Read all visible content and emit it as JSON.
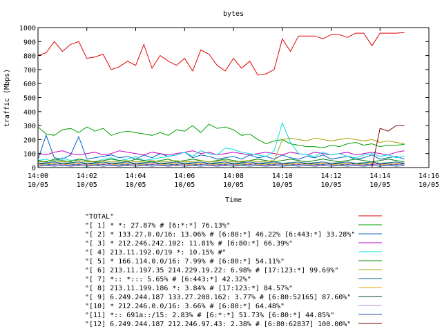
{
  "chart_data": {
    "type": "line",
    "title": "bytes",
    "xlabel": "Time",
    "ylabel": "traffic (Mbps)",
    "ylim": [
      0,
      1000
    ],
    "yticks": [
      0,
      100,
      200,
      300,
      400,
      500,
      600,
      700,
      800,
      900,
      1000
    ],
    "xlim": [
      "14:00",
      "14:16"
    ],
    "xticks": [
      {
        "time": "14:00",
        "date": "10/05"
      },
      {
        "time": "14:02",
        "date": "10/05"
      },
      {
        "time": "14:04",
        "date": "10/05"
      },
      {
        "time": "14:06",
        "date": "10/05"
      },
      {
        "time": "14:08",
        "date": "10/05"
      },
      {
        "time": "14:10",
        "date": "10/05"
      },
      {
        "time": "14:12",
        "date": "10/05"
      },
      {
        "time": "14:14",
        "date": "10/05"
      },
      {
        "time": "14:16",
        "date": "10/05"
      }
    ],
    "grid": false,
    "legend_position": "bottom",
    "x": [
      "14:00",
      "14:00:20",
      "14:00:40",
      "14:01",
      "14:01:20",
      "14:01:40",
      "14:02",
      "14:02:20",
      "14:02:40",
      "14:03",
      "14:03:20",
      "14:03:40",
      "14:04",
      "14:04:20",
      "14:04:40",
      "14:05",
      "14:05:20",
      "14:05:40",
      "14:06",
      "14:06:20",
      "14:06:40",
      "14:07",
      "14:07:20",
      "14:07:40",
      "14:08",
      "14:08:20",
      "14:08:40",
      "14:09",
      "14:09:20",
      "14:09:40",
      "14:10",
      "14:10:20",
      "14:10:40",
      "14:11",
      "14:11:20",
      "14:11:40",
      "14:12",
      "14:12:20",
      "14:12:40",
      "14:13",
      "14:13:20",
      "14:13:40",
      "14:14",
      "14:14:20",
      "14:14:40",
      "14:15"
    ],
    "series": [
      {
        "name": "\"TOTAL\"",
        "color": "#e00000",
        "values": [
          800,
          820,
          900,
          830,
          880,
          900,
          780,
          790,
          810,
          700,
          720,
          760,
          730,
          880,
          710,
          800,
          760,
          730,
          780,
          690,
          840,
          810,
          730,
          690,
          780,
          710,
          760,
          660,
          670,
          700,
          920,
          830,
          940,
          940,
          940,
          920,
          950,
          950,
          930,
          960,
          960,
          870,
          960,
          960,
          960,
          965
        ]
      },
      {
        "name": "\"[ 1] * *: 27.87% # [6:*:*] 76.13%\"",
        "color": "#00a000",
        "values": [
          290,
          240,
          230,
          270,
          280,
          250,
          290,
          260,
          280,
          230,
          250,
          260,
          250,
          240,
          230,
          250,
          230,
          270,
          260,
          300,
          250,
          310,
          280,
          290,
          270,
          230,
          240,
          200,
          170,
          190,
          200,
          170,
          160,
          150,
          150,
          140,
          160,
          150,
          170,
          180,
          160,
          170,
          150,
          160,
          160,
          165
        ]
      },
      {
        "name": "\"[ 2] * 133.27.0.0/16: 13.06% # [6:80:*] 46.22% [6:443:*] 33.28%\"",
        "color": "#0060c0",
        "values": [
          60,
          230,
          70,
          60,
          90,
          220,
          60,
          70,
          80,
          90,
          70,
          80,
          60,
          90,
          70,
          100,
          80,
          90,
          110,
          70,
          90,
          80,
          60,
          70,
          80,
          60,
          90,
          70,
          80,
          60,
          90,
          70,
          60,
          80,
          70,
          90,
          60,
          70,
          80,
          60,
          70,
          90,
          60,
          70,
          80,
          60
        ]
      },
      {
        "name": "\"[ 3] * 212.246.242.102: 11.81% # [6:80:*] 66.39%\"",
        "color": "#c000c0",
        "values": [
          100,
          90,
          110,
          120,
          100,
          90,
          100,
          110,
          90,
          100,
          120,
          110,
          100,
          90,
          110,
          100,
          90,
          100,
          110,
          120,
          100,
          110,
          90,
          100,
          110,
          100,
          90,
          100,
          110,
          100,
          90,
          110,
          100,
          90,
          110,
          100,
          90,
          100,
          110,
          90,
          100,
          110,
          100,
          90,
          110,
          120
        ]
      },
      {
        "name": "\"[ 4] 213.11.192.0/19 *: 10.15% #\"",
        "color": "#00e0e0",
        "values": [
          50,
          60,
          40,
          70,
          50,
          60,
          50,
          40,
          60,
          70,
          50,
          60,
          80,
          50,
          60,
          70,
          80,
          90,
          110,
          80,
          120,
          100,
          90,
          140,
          130,
          110,
          100,
          90,
          80,
          120,
          320,
          180,
          100,
          90,
          80,
          110,
          90,
          100,
          80,
          70,
          90,
          100,
          80,
          90,
          70,
          80
        ]
      },
      {
        "name": "\"[ 5] * 166.114.0.0/16: 7.99% # [6:80:*] 54.11%\"",
        "color": "#008000",
        "values": [
          50,
          40,
          60,
          50,
          40,
          60,
          50,
          40,
          50,
          60,
          50,
          40,
          60,
          50,
          40,
          50,
          60,
          40,
          50,
          60,
          50,
          40,
          50,
          60,
          50,
          40,
          50,
          60,
          50,
          40,
          50,
          60,
          50,
          40,
          50,
          60,
          50,
          40,
          50,
          60,
          50,
          40,
          50,
          60,
          50,
          40
        ]
      },
      {
        "name": "\"[ 6] 213.11.197.35 214.229.19.22: 6.98% # [17:123:*] 99.69%\"",
        "color": "#a0a000",
        "values": [
          40,
          45,
          50,
          40,
          45,
          50,
          40,
          45,
          50,
          40,
          45,
          50,
          40,
          45,
          50,
          40,
          45,
          50,
          40,
          45,
          50,
          40,
          45,
          50,
          40,
          45,
          50,
          40,
          45,
          50,
          200,
          210,
          200,
          190,
          210,
          200,
          190,
          200,
          210,
          200,
          190,
          200,
          180,
          190,
          180,
          170
        ]
      },
      {
        "name": "\"[ 7] *:: *::: 5.65% # [6:443:*] 42.32%\"",
        "color": "#006080",
        "values": [
          30,
          35,
          40,
          30,
          35,
          40,
          30,
          35,
          40,
          30,
          35,
          40,
          30,
          35,
          40,
          30,
          35,
          40,
          30,
          35,
          40,
          30,
          35,
          40,
          30,
          35,
          40,
          30,
          35,
          40,
          30,
          35,
          40,
          30,
          35,
          40,
          30,
          35,
          40,
          30,
          35,
          40,
          30,
          35,
          40,
          30
        ]
      },
      {
        "name": "\"[ 8] 213.11.199.186 *: 3.84% # [17:123:*] 84.57%\"",
        "color": "#f0a000",
        "values": [
          20,
          25,
          30,
          20,
          25,
          30,
          20,
          25,
          30,
          20,
          25,
          30,
          20,
          25,
          30,
          20,
          25,
          30,
          20,
          25,
          30,
          20,
          25,
          30,
          20,
          25,
          30,
          20,
          25,
          30,
          20,
          25,
          30,
          20,
          25,
          30,
          20,
          25,
          30,
          20,
          25,
          30,
          20,
          25,
          30,
          20
        ]
      },
      {
        "name": "\"[ 9] 6.249.244.187 133.27.208.162: 3.77% # [6:80:52165] 87.60%\"",
        "color": "#004040",
        "values": [
          30,
          25,
          20,
          30,
          25,
          20,
          30,
          25,
          20,
          30,
          25,
          20,
          30,
          25,
          20,
          30,
          25,
          20,
          30,
          25,
          20,
          30,
          25,
          20,
          30,
          25,
          20,
          30,
          25,
          20,
          30,
          25,
          20,
          30,
          25,
          20,
          30,
          25,
          20,
          30,
          25,
          20,
          30,
          25,
          20,
          30
        ]
      },
      {
        "name": "\"[10] * 212.246.0.0/16: 3.66% # [6:80:*] 64.48%\"",
        "color": "#b080e0",
        "values": [
          20,
          15,
          25,
          20,
          15,
          25,
          20,
          15,
          25,
          20,
          15,
          25,
          20,
          15,
          25,
          20,
          15,
          25,
          20,
          15,
          25,
          20,
          15,
          25,
          20,
          15,
          25,
          20,
          15,
          25,
          20,
          15,
          25,
          20,
          15,
          25,
          20,
          15,
          25,
          20,
          15,
          25,
          20,
          15,
          25,
          20
        ]
      },
      {
        "name": "\"[11] *:: 691a::/15: 2.83% # [6:*:*] 51.73% [6:80:*] 44.85%\"",
        "color": "#2050a0",
        "values": [
          10,
          15,
          10,
          15,
          10,
          15,
          10,
          15,
          10,
          15,
          10,
          15,
          10,
          15,
          10,
          15,
          10,
          15,
          10,
          15,
          10,
          15,
          10,
          15,
          10,
          15,
          10,
          15,
          10,
          15,
          10,
          15,
          10,
          15,
          10,
          15,
          10,
          15,
          10,
          15,
          10,
          15,
          10,
          15,
          10,
          15
        ]
      },
      {
        "name": "\"[12] 6.249.244.187 212.246.97.43: 2.38% # [6:80:62837] 100.00%\"",
        "color": "#800000",
        "values": [
          null,
          null,
          null,
          null,
          null,
          null,
          null,
          null,
          null,
          null,
          null,
          null,
          null,
          null,
          null,
          null,
          null,
          null,
          null,
          null,
          null,
          null,
          null,
          null,
          null,
          null,
          null,
          null,
          null,
          null,
          null,
          null,
          null,
          null,
          null,
          null,
          null,
          null,
          null,
          null,
          null,
          0,
          280,
          260,
          300,
          300
        ]
      }
    ]
  }
}
